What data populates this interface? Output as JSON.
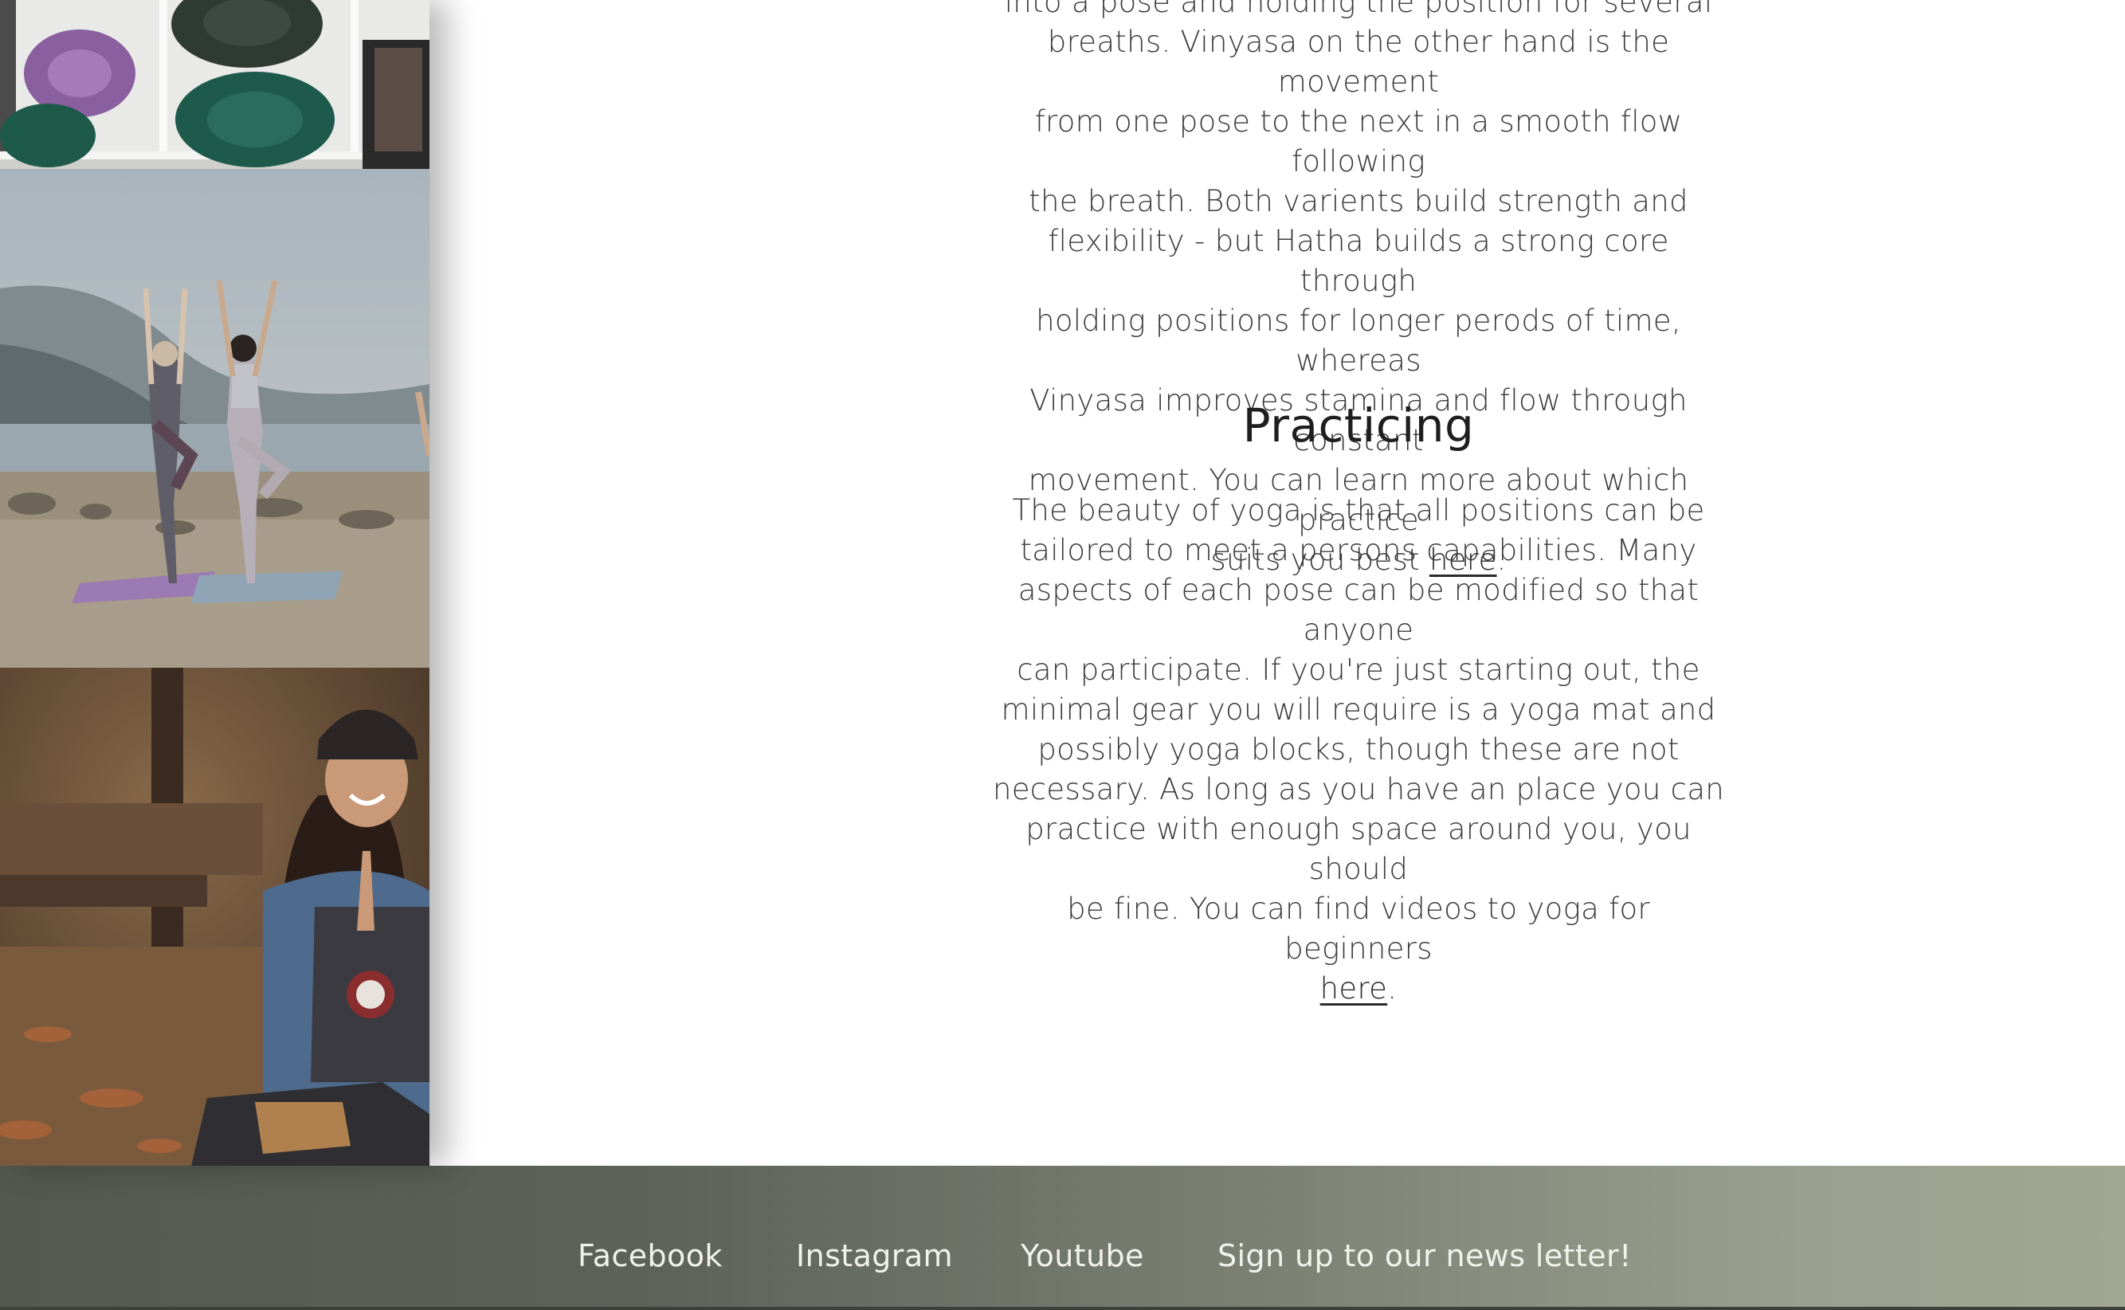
{
  "article": {
    "intro_lines": [
      "into a pose and holding the position for several",
      "breaths. Vinyasa on the other hand is the movement",
      "from one pose to the next in a smooth flow following",
      "the breath. Both varients build strength and",
      "flexibility - but Hatha builds a strong core through",
      "holding positions for longer perods of time, whereas",
      "Vinyasa improves stamina and flow through constant",
      "movement. You can learn more about which practice"
    ],
    "intro_last_prefix": "suits you best ",
    "intro_link": "here",
    "intro_suffix": ".",
    "heading": "Practicing",
    "practice_lines": [
      "The beauty of yoga is that all positions can be",
      "tailored to meet a persons capabilities. Many",
      "aspects of each pose can be modified so that anyone",
      "can participate. If you're just starting out, the",
      "minimal gear you will require is a yoga mat and",
      "possibly yoga blocks, though these are not",
      "necessary. As long as you have an place you can",
      "practice with enough space around you, you should",
      "be fine. You can find videos to yoga for beginners"
    ],
    "practice_link": "here",
    "practice_suffix": "."
  },
  "sidebar": {
    "photos": [
      {
        "name": "yoga-mats-shelf-photo"
      },
      {
        "name": "beach-tree-pose-photo"
      },
      {
        "name": "woman-meditating-photo"
      }
    ]
  },
  "footer": {
    "links": {
      "facebook": "Facebook",
      "instagram": "Instagram",
      "youtube": "Youtube",
      "newsletter": "Sign up to our news letter!"
    }
  }
}
